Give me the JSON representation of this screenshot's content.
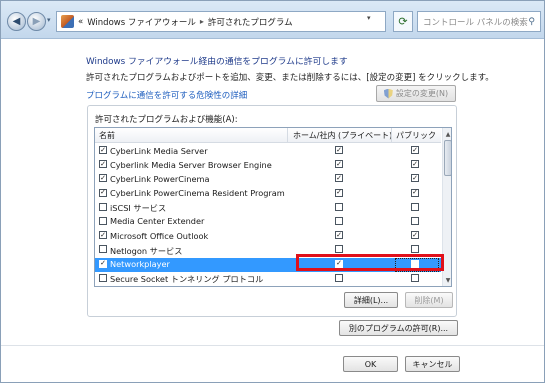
{
  "addressbar": {
    "history_label": "«",
    "crumbs": [
      "Windows ファイアウォール",
      "許可されたプログラム"
    ],
    "separator": "▸",
    "search_placeholder": "コントロール パネルの検索"
  },
  "content": {
    "heading": "Windows ファイアウォール経由の通信をプログラムに許可します",
    "description": "許可されたプログラムおよびポートを追加、変更、または削除するには、[設定の変更] をクリックします。",
    "risk_link": "プログラムに通信を許可する危険性の詳細",
    "change_settings_label": "設定の変更(N)"
  },
  "list": {
    "group_title": "許可されたプログラムおよび機能(A):",
    "columns": {
      "name": "名前",
      "home": "ホーム/社内 (プライベート)",
      "public": "パブリック"
    },
    "rows": [
      {
        "name": "CyberLink Media Server",
        "enabled": true,
        "home": true,
        "public": true
      },
      {
        "name": "Cyberlink Media Server Browser Engine",
        "enabled": true,
        "home": true,
        "public": true
      },
      {
        "name": "CyberLink PowerCinema",
        "enabled": true,
        "home": true,
        "public": true
      },
      {
        "name": "CyberLink PowerCinema Resident Program",
        "enabled": true,
        "home": true,
        "public": true
      },
      {
        "name": "iSCSI サービス",
        "enabled": false,
        "home": false,
        "public": false
      },
      {
        "name": "Media Center Extender",
        "enabled": false,
        "home": false,
        "public": false
      },
      {
        "name": "Microsoft Office Outlook",
        "enabled": true,
        "home": true,
        "public": true
      },
      {
        "name": "Netlogon サービス",
        "enabled": false,
        "home": false,
        "public": false
      },
      {
        "name": "Networkplayer",
        "enabled": true,
        "home": true,
        "public": false,
        "selected": true
      },
      {
        "name": "Secure Socket トンネリング プロトコル",
        "enabled": false,
        "home": false,
        "public": false
      }
    ]
  },
  "buttons": {
    "details": "詳細(L)...",
    "delete": "削除(M)",
    "allow_other": "別のプログラムの許可(R)...",
    "ok": "OK",
    "cancel": "キャンセル"
  },
  "colors": {
    "selection": "#3399ff",
    "highlight_frame": "#e0101a",
    "heading": "#1e3a8a",
    "link": "#1f5fbf"
  },
  "icons": [
    "back-arrow-icon",
    "forward-arrow-icon",
    "firewall-icon",
    "refresh-icon",
    "search-icon",
    "shield-icon",
    "checkbox-icon"
  ]
}
